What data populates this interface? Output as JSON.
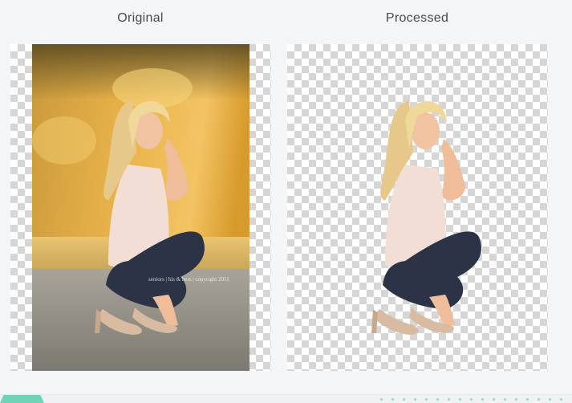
{
  "labels": {
    "original": "Original",
    "processed": "Processed"
  },
  "watermark": "seniors | his & hers | copyright 2011",
  "colors": {
    "page_background": "#f4f5f7",
    "checker_light": "#ffffff",
    "checker_dark": "#d6d6d6",
    "accent": "#6fd3b6"
  },
  "icons": {
    "transparency": "checkerboard-pattern"
  }
}
